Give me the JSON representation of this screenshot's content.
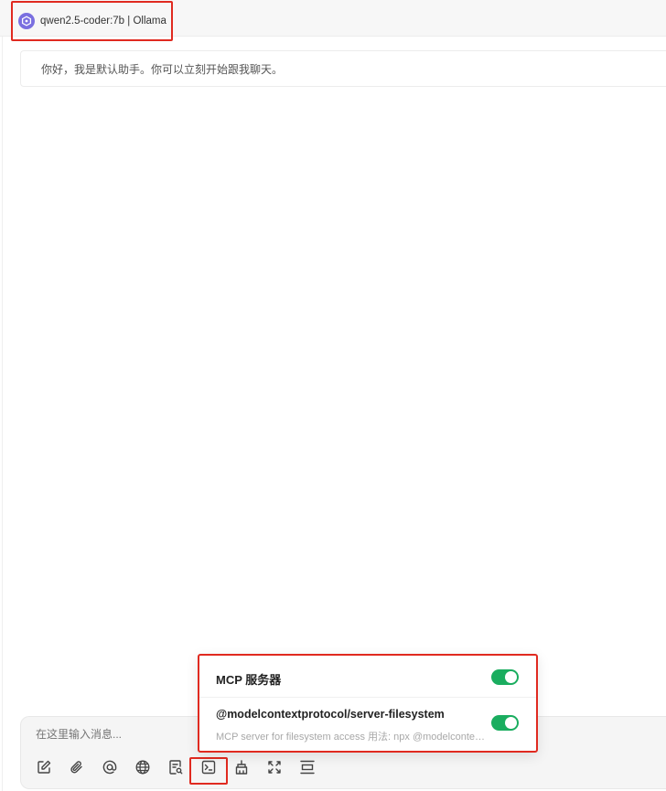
{
  "header": {
    "model_label": "qwen2.5-coder:7b | Ollama",
    "logo_icon": "ollama-logo-icon",
    "logo_color": "#7a6fe0"
  },
  "chat": {
    "assistant_greeting": "你好，我是默认助手。你可以立刻开始跟我聊天。"
  },
  "composer": {
    "placeholder": "在这里输入消息...",
    "toolbar": [
      {
        "name": "new-topic-icon"
      },
      {
        "name": "attachment-icon"
      },
      {
        "name": "mention-icon"
      },
      {
        "name": "web-search-icon"
      },
      {
        "name": "knowledge-base-icon"
      },
      {
        "name": "mcp-terminal-icon"
      },
      {
        "name": "clear-context-icon"
      },
      {
        "name": "expand-icon"
      },
      {
        "name": "new-context-icon"
      }
    ]
  },
  "mcp_popup": {
    "title": "MCP 服务器",
    "master_enabled": true,
    "servers": [
      {
        "name": "@modelcontextprotocol/server-filesystem",
        "description": "MCP server for filesystem access 用法: npx @modelcontextprotocol/server-filesystem",
        "enabled": true
      }
    ]
  },
  "colors": {
    "highlight": "#e02a20",
    "toggle_on": "#1aad5f"
  }
}
